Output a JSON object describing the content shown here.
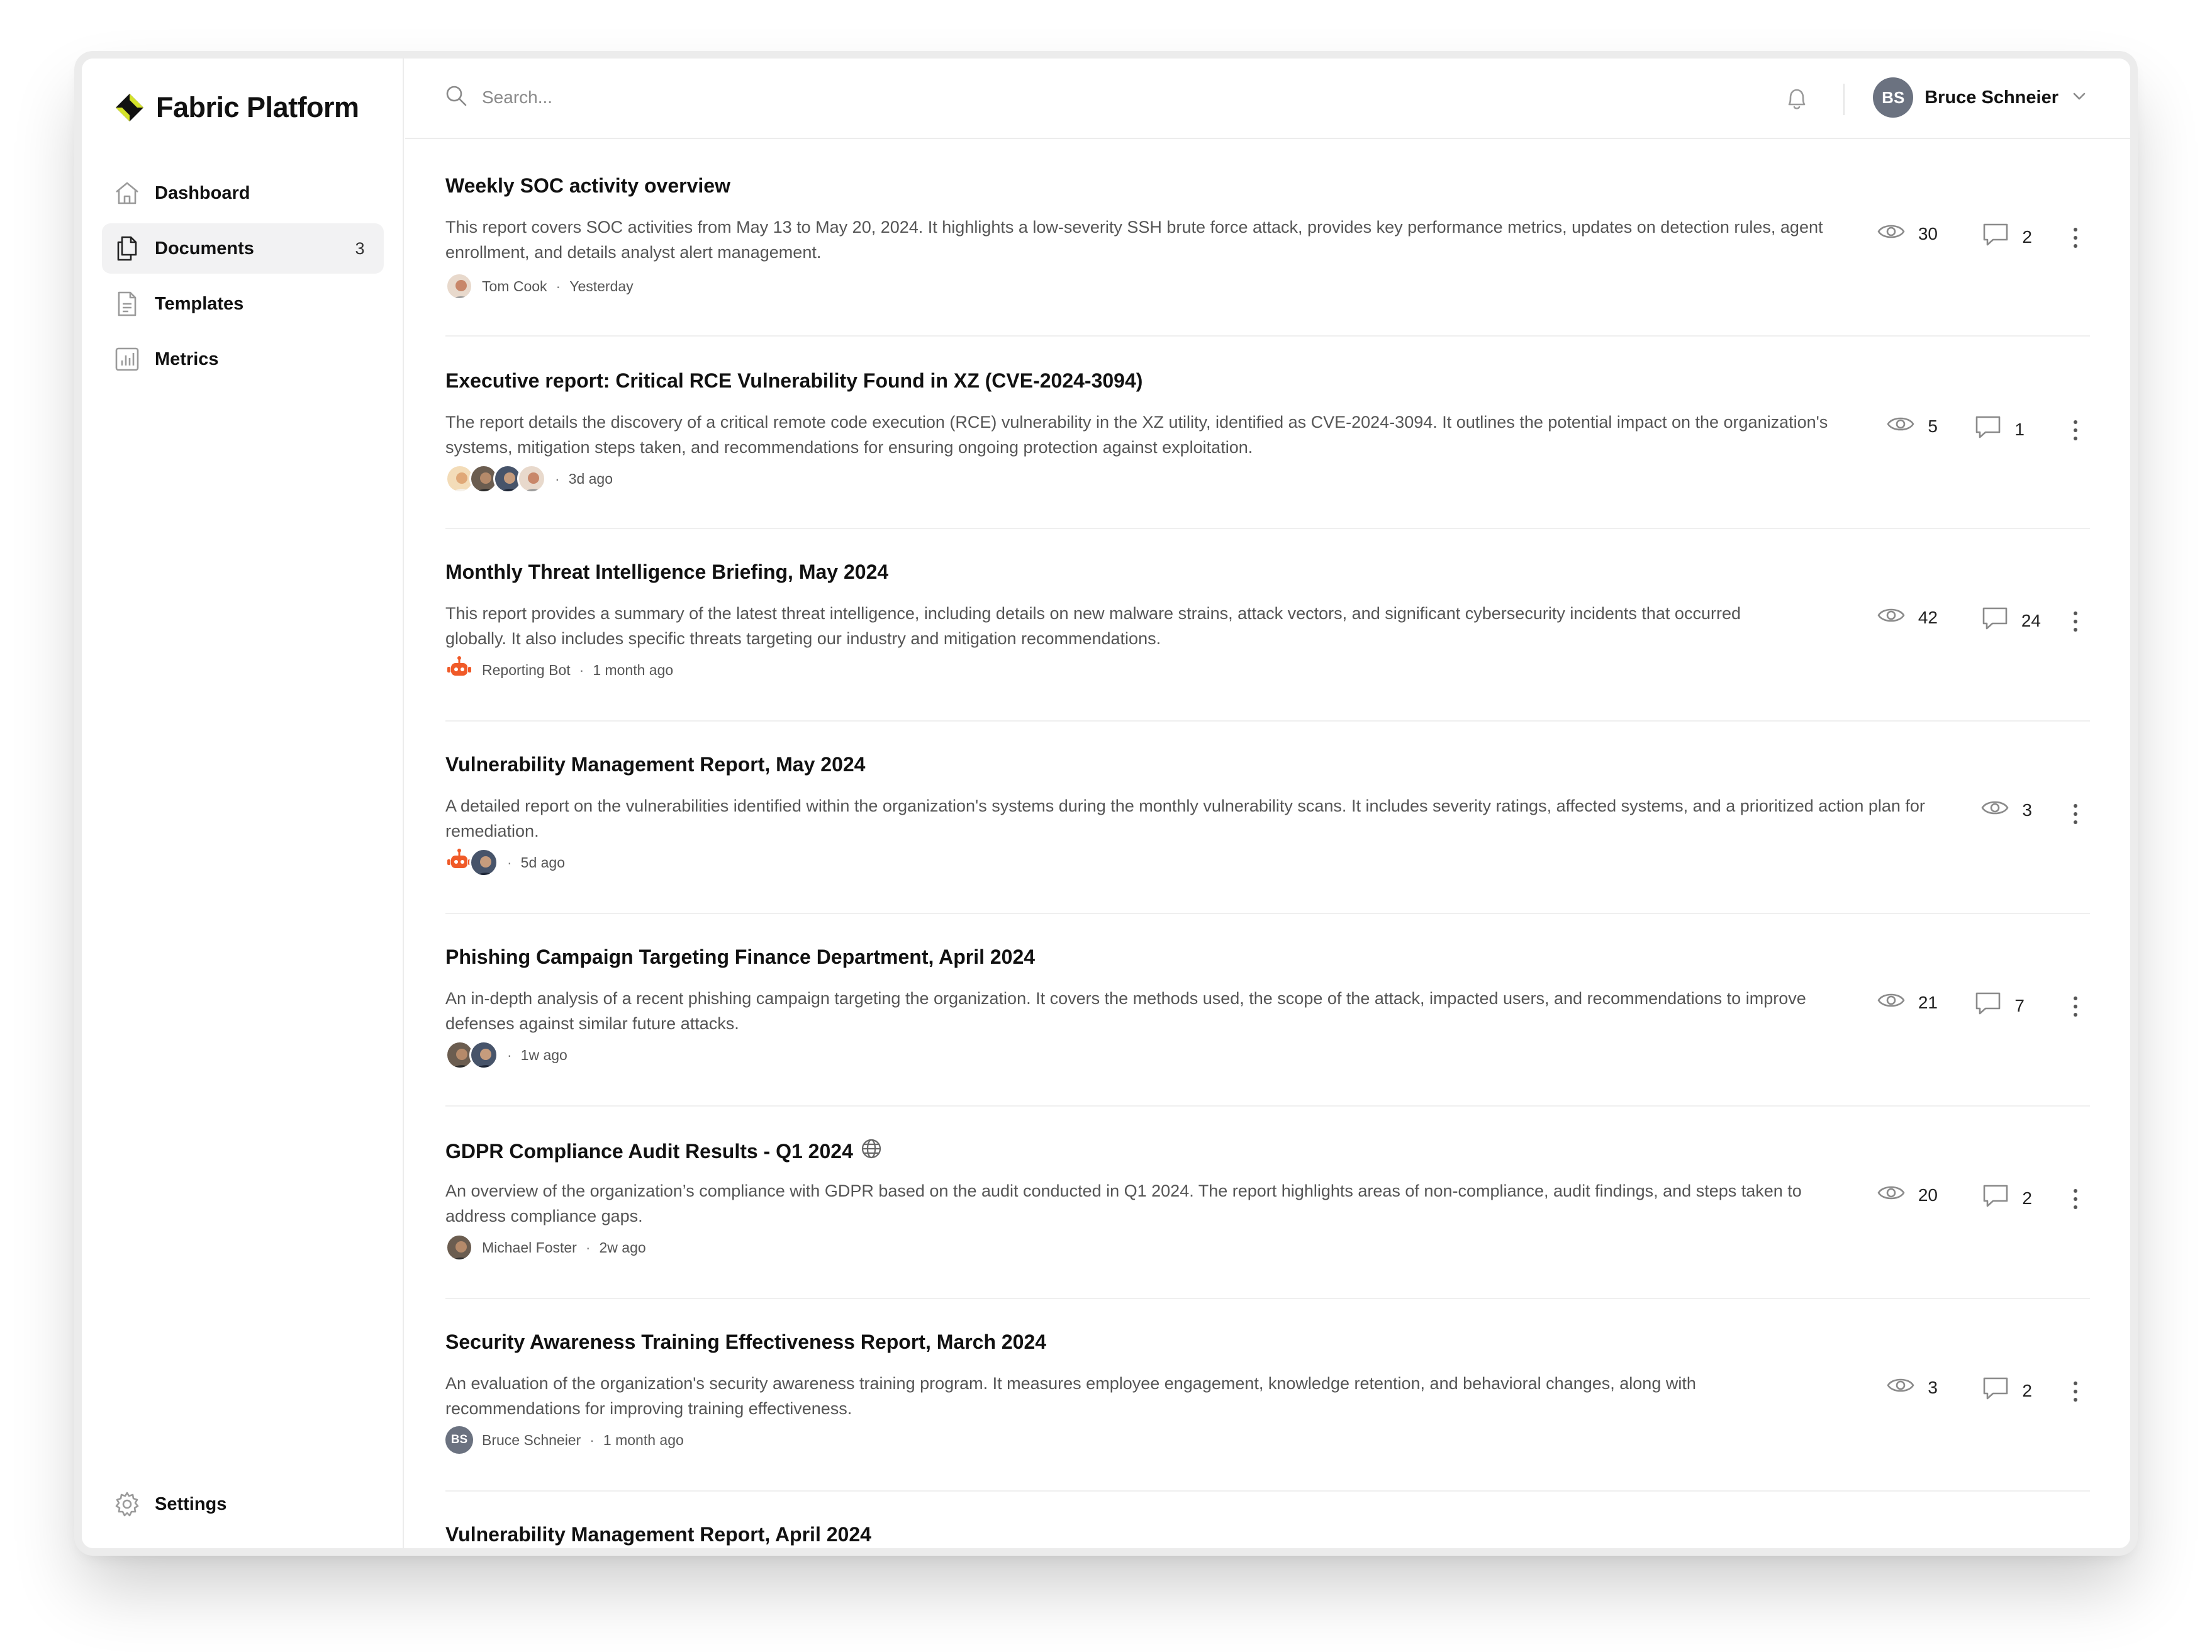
{
  "app": {
    "name": "Fabric Platform"
  },
  "sidebar": {
    "items": [
      {
        "label": "Dashboard",
        "icon": "home-icon"
      },
      {
        "label": "Documents",
        "icon": "documents-icon",
        "count": "3",
        "active": true
      },
      {
        "label": "Templates",
        "icon": "template-icon"
      },
      {
        "label": "Metrics",
        "icon": "chart-icon"
      }
    ],
    "settings_label": "Settings"
  },
  "topbar": {
    "search_placeholder": "Search...",
    "user": {
      "initials": "BS",
      "name": "Bruce Schneier"
    }
  },
  "documents": [
    {
      "title": "Weekly SOC activity overview",
      "description": "This report covers SOC activities from May 13 to May 20, 2024. It highlights a low-severity SSH brute force attack, provides key performance metrics, updates on detection rules, agent enrollment, and details analyst alert management.",
      "author": "Tom Cook",
      "time": "Yesterday",
      "views": "30",
      "comments": "2"
    },
    {
      "title": "Executive report: Critical RCE Vulnerability Found in XZ (CVE-2024-3094)",
      "description": "The report details the discovery of a critical remote code execution (RCE) vulnerability in the XZ utility, identified as CVE-2024-3094. It outlines the potential impact on the organization's systems, mitigation steps taken, and recommendations for ensuring ongoing protection against exploitation.",
      "author": "",
      "time": "3d ago",
      "views": "5",
      "comments": "1"
    },
    {
      "title": "Monthly Threat Intelligence Briefing, May 2024",
      "description": "This report provides a summary of the latest threat intelligence, including details on new malware strains, attack vectors, and significant cybersecurity incidents that occurred globally. It also includes specific threats targeting our industry and mitigation recommendations.",
      "author": "Reporting Bot",
      "time": "1 month ago",
      "views": "42",
      "comments": "24"
    },
    {
      "title": "Vulnerability Management Report, May 2024",
      "description": "A detailed report on the vulnerabilities identified within the organization's systems during the monthly vulnerability scans. It includes severity ratings, affected systems, and a prioritized action plan for remediation.",
      "author": "",
      "time": "5d ago",
      "views": "3",
      "comments": ""
    },
    {
      "title": "Phishing Campaign Targeting Finance Department, April 2024",
      "description": "An in-depth analysis of a recent phishing campaign targeting the organization. It covers the methods used, the scope of the attack, impacted users, and recommendations to improve defenses against similar future attacks.",
      "author": "",
      "time": "1w ago",
      "views": "21",
      "comments": "7"
    },
    {
      "title": "GDPR Compliance Audit Results - Q1 2024",
      "description": "An overview of the organization’s compliance with GDPR based on the audit conducted in Q1 2024. The report highlights areas of non-compliance, audit findings, and steps taken to address compliance gaps.",
      "author": "Michael Foster",
      "time": "2w ago",
      "views": "20",
      "comments": "2"
    },
    {
      "title": "Security Awareness Training Effectiveness Report, March 2024",
      "description": "An evaluation of the organization's security awareness training program. It measures employee engagement, knowledge retention, and behavioral changes, along with recommendations for improving training effectiveness.",
      "author": "Bruce Schneier",
      "author_initials": "BS",
      "time": "1 month ago",
      "views": "3",
      "comments": "2"
    },
    {
      "title": "Vulnerability Management Report, April 2024"
    }
  ],
  "meta_separator": "·",
  "colors": {
    "accent_bot": "#f05a28",
    "brand_yellow": "#d4e22a",
    "border": "#ececec"
  }
}
